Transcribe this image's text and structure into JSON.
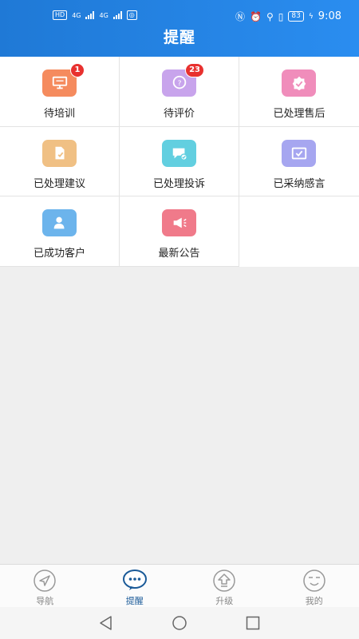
{
  "status_bar": {
    "left_chip": "HD",
    "network_1": "4G",
    "network_2": "4G",
    "battery": "83",
    "time": "9:08"
  },
  "header": {
    "title": "提醒"
  },
  "grid": [
    {
      "label": "待培训",
      "badge": "1",
      "color": "#f58b5e",
      "icon": "presentation-icon"
    },
    {
      "label": "待评价",
      "badge": "23",
      "color": "#c8a4ec",
      "icon": "question-chat-icon"
    },
    {
      "label": "已处理售后",
      "badge": "",
      "color": "#f08dbb",
      "icon": "certified-badge-icon"
    },
    {
      "label": "已处理建议",
      "badge": "",
      "color": "#f0c084",
      "icon": "document-check-icon"
    },
    {
      "label": "已处理投诉",
      "badge": "",
      "color": "#62cfe0",
      "icon": "message-check-icon"
    },
    {
      "label": "已采纳感言",
      "badge": "",
      "color": "#a6a6f0",
      "icon": "mail-check-icon"
    },
    {
      "label": "已成功客户",
      "badge": "",
      "color": "#6cb4ec",
      "icon": "customer-icon"
    },
    {
      "label": "最新公告",
      "badge": "",
      "color": "#f07a8a",
      "icon": "megaphone-icon"
    }
  ],
  "bottom_nav": [
    {
      "label": "导航",
      "icon": "navigation-arrow-icon",
      "active": false
    },
    {
      "label": "提醒",
      "icon": "chat-bubble-icon",
      "active": true
    },
    {
      "label": "升级",
      "icon": "upgrade-arrow-icon",
      "active": false
    },
    {
      "label": "我的",
      "icon": "smiley-face-icon",
      "active": false
    }
  ],
  "colors": {
    "header": "#2a8df0",
    "active_nav": "#1a5a98",
    "badge": "#e8312f"
  }
}
